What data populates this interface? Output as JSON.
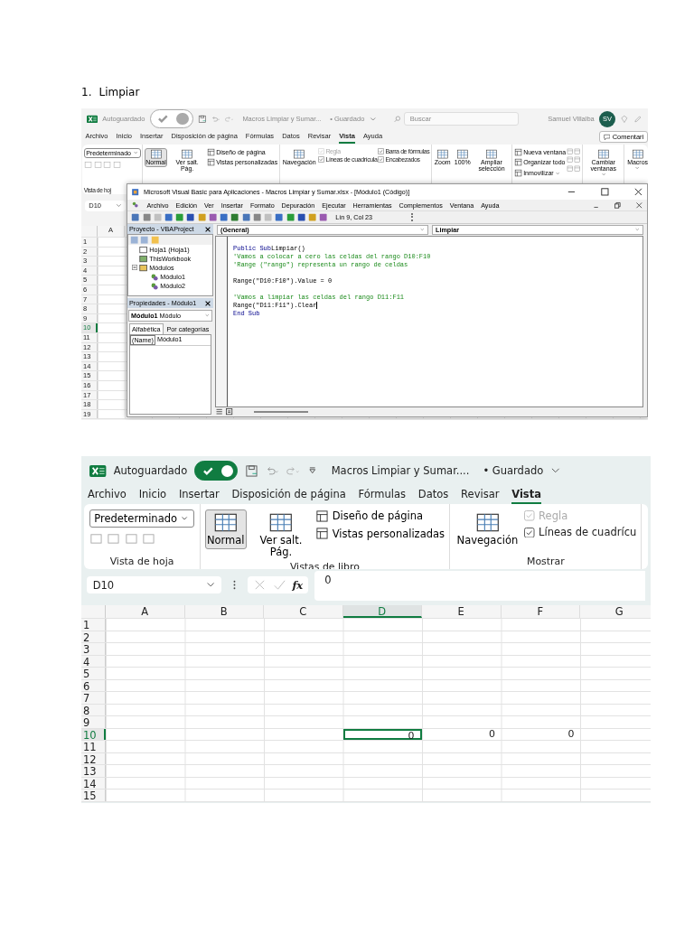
{
  "heading": {
    "number": "1.",
    "title": "Limpiar"
  },
  "screenshots": [
    {
      "title_bar": {
        "autosave_label": "Autoguardado",
        "autosave_on": true,
        "document": "Macros Limpiar y Sumar...",
        "saved_status": "• Guardado",
        "search_placeholder": "Buscar",
        "user": "Samuel Villalba",
        "avatar": "SV"
      },
      "menu_tabs": [
        {
          "label": "Archivo",
          "selected": false
        },
        {
          "label": "Inicio",
          "selected": false
        },
        {
          "label": "Insertar",
          "selected": false
        },
        {
          "label": "Disposición de página",
          "selected": false
        },
        {
          "label": "Fórmulas",
          "selected": false
        },
        {
          "label": "Datos",
          "selected": false
        },
        {
          "label": "Revisar",
          "selected": false
        },
        {
          "label": "Vista",
          "selected": true
        },
        {
          "label": "Ayuda",
          "selected": false
        }
      ],
      "comments_button": "Comentari",
      "ribbon_groups": [
        {
          "label": "Vista de hoj",
          "columns": [
            [
              {
                "kind": "dropdown",
                "label": "Predeterminado"
              },
              {
                "kind": "icon_row"
              }
            ]
          ]
        },
        {
          "columns": [
            [
              {
                "kind": "big",
                "label": "Normal",
                "selected": true
              }
            ],
            [
              {
                "kind": "big",
                "label": "Ver salt. Pág.",
                "selected": false
              }
            ],
            [
              {
                "kind": "small",
                "label": "Diseño de página"
              },
              {
                "kind": "small",
                "label": "Vistas personalizadas"
              }
            ]
          ]
        },
        {
          "columns": [
            [
              {
                "kind": "big",
                "label": "Navegación"
              }
            ],
            [
              {
                "kind": "check",
                "label": "Regla",
                "checked": true,
                "disabled": true
              },
              {
                "kind": "check",
                "label": "Líneas de cuadrícula",
                "checked": true,
                "disabled": false
              }
            ],
            [
              {
                "kind": "check",
                "label": "Barra de fórmulas",
                "checked": true,
                "disabled": false
              },
              {
                "kind": "check",
                "label": "Encabezados",
                "checked": true,
                "disabled": false
              }
            ]
          ]
        },
        {
          "columns": [
            [
              {
                "kind": "big",
                "label": "Zoom"
              }
            ],
            [
              {
                "kind": "big",
                "label": "100%"
              }
            ],
            [
              {
                "kind": "big",
                "label": "Ampliar selección"
              }
            ]
          ]
        },
        {
          "columns": [
            [
              {
                "kind": "small",
                "label": "Nueva ventana"
              },
              {
                "kind": "small",
                "label": "Organizar todo"
              },
              {
                "kind": "small",
                "label": "Inmovilizar",
                "menu": true
              }
            ],
            [
              {
                "kind": "icon_column"
              }
            ],
            [
              {
                "kind": "icon_column"
              }
            ]
          ]
        },
        {
          "columns": [
            [
              {
                "kind": "big",
                "label": "Cambiar ventanas",
                "menu": true
              }
            ]
          ]
        },
        {
          "columns": [
            [
              {
                "kind": "big",
                "label": "Macros",
                "menu": true
              }
            ]
          ]
        }
      ],
      "formula_bar": {
        "name_box": "D10"
      },
      "grid": {
        "columns": [
          {
            "label": "A",
            "selected": false
          }
        ],
        "rows": [
          {
            "label": "1",
            "selected": false
          },
          {
            "label": "2",
            "selected": false
          },
          {
            "label": "3",
            "selected": false
          },
          {
            "label": "4",
            "selected": false
          },
          {
            "label": "5",
            "selected": false
          },
          {
            "label": "6",
            "selected": false
          },
          {
            "label": "7",
            "selected": false
          },
          {
            "label": "8",
            "selected": false
          },
          {
            "label": "9",
            "selected": false
          },
          {
            "label": "10",
            "selected": true
          },
          {
            "label": "11",
            "selected": false
          },
          {
            "label": "12",
            "selected": false
          },
          {
            "label": "13",
            "selected": false
          },
          {
            "label": "14",
            "selected": false
          },
          {
            "label": "15",
            "selected": false
          },
          {
            "label": "16",
            "selected": false
          },
          {
            "label": "17",
            "selected": false
          },
          {
            "label": "18",
            "selected": false
          },
          {
            "label": "19",
            "selected": false
          }
        ]
      },
      "vba_window": {
        "title": "Microsoft Visual Basic para Aplicaciones - Macros Limpiar y Sumar.xlsx - [Módulo1 (Código)]",
        "menu": [
          "Archivo",
          "Edición",
          "Ver",
          "Insertar",
          "Formato",
          "Depuración",
          "Ejecutar",
          "Herramientas",
          "Complementos",
          "Ventana",
          "Ayuda"
        ],
        "position": "Lín 9, Col 23",
        "project_panel": {
          "title": "Proyecto - VBAProject",
          "tree": [
            {
              "label": "Hoja1 (Hoja1)",
              "kind": "sheet"
            },
            {
              "label": "ThisWorkbook",
              "kind": "workbook"
            },
            {
              "label": "Módulos",
              "kind": "folder",
              "expanded": true,
              "children": [
                {
                  "label": "Módulo1",
                  "kind": "module"
                },
                {
                  "label": "Módulo2",
                  "kind": "module"
                }
              ]
            }
          ]
        },
        "properties_panel": {
          "title": "Propiedades - Módulo1",
          "object_name": "Módulo1",
          "object_type": "Módulo",
          "tabs": [
            {
              "label": "Alfabética",
              "selected": true
            },
            {
              "label": "Por categorías",
              "selected": false
            }
          ],
          "rows": [
            {
              "name": "(Name)",
              "value": "Módulo1"
            }
          ]
        },
        "object_dropdown": "(General)",
        "procedure_dropdown": "Limpiar",
        "code": [
          {
            "kind": "code",
            "cursor": false,
            "tokens": [
              {
                "text": "Public Sub",
                "kind": "keyword"
              },
              {
                "text": "Limpiar()",
                "kind": "plain"
              }
            ]
          },
          {
            "kind": "code",
            "cursor": false,
            "tokens": [
              {
                "text": "'Vamos a colocar a cero las celdas del rango D10:F10",
                "kind": "comment"
              }
            ]
          },
          {
            "kind": "code",
            "cursor": false,
            "tokens": [
              {
                "text": "'Range (\"rango\") representa un rango de celdas",
                "kind": "comment"
              }
            ]
          },
          {
            "kind": "blank"
          },
          {
            "kind": "code",
            "cursor": false,
            "tokens": [
              {
                "text": "Range(\"D10:F10\").Value = 0",
                "kind": "plain"
              }
            ]
          },
          {
            "kind": "blank"
          },
          {
            "kind": "code",
            "cursor": false,
            "tokens": [
              {
                "text": "'Vamos a limpiar las celdas del rango D11:F11",
                "kind": "comment"
              }
            ]
          },
          {
            "kind": "code",
            "cursor": true,
            "tokens": [
              {
                "text": "Range(\"D11:F11\").Clear",
                "kind": "plain"
              }
            ]
          },
          {
            "kind": "code",
            "cursor": false,
            "tokens": [
              {
                "text": "End Sub",
                "kind": "keyword"
              }
            ]
          }
        ]
      }
    },
    {
      "title_bar": {
        "autosave_label": "Autoguardado",
        "autosave_on": true,
        "document": "Macros Limpiar y Sumar....",
        "saved_status": "• Guardado"
      },
      "menu_tabs": [
        {
          "label": "Archivo",
          "selected": false
        },
        {
          "label": "Inicio",
          "selected": false
        },
        {
          "label": "Insertar",
          "selected": false
        },
        {
          "label": "Disposición de página",
          "selected": false
        },
        {
          "label": "Fórmulas",
          "selected": false
        },
        {
          "label": "Datos",
          "selected": false
        },
        {
          "label": "Revisar",
          "selected": false
        },
        {
          "label": "Vista",
          "selected": true
        }
      ],
      "ribbon_groups": [
        {
          "label": "Vista de hoja",
          "columns": [
            [
              {
                "kind": "dropdown",
                "label": "Predeterminado"
              },
              {
                "kind": "icon_row"
              }
            ]
          ]
        },
        {
          "label": "Vistas de libro",
          "columns": [
            [
              {
                "kind": "big",
                "label": "Normal",
                "selected": true
              }
            ],
            [
              {
                "kind": "big",
                "label": "Ver salt. Pág.",
                "selected": false
              }
            ],
            [
              {
                "kind": "small",
                "label": "Diseño de página"
              },
              {
                "kind": "small",
                "label": "Vistas personalizadas"
              }
            ]
          ]
        },
        {
          "label": "Mostrar",
          "columns": [
            [
              {
                "kind": "big",
                "label": "Navegación"
              }
            ],
            [
              {
                "kind": "check",
                "label": "Regla",
                "checked": true,
                "disabled": true
              },
              {
                "kind": "check",
                "label": "Líneas de cuadrícu",
                "checked": true,
                "disabled": false
              }
            ]
          ]
        }
      ],
      "formula_bar": {
        "name_box": "D10",
        "function_symbol": "fx",
        "formula": "0"
      },
      "grid": {
        "columns": [
          {
            "label": "A",
            "selected": false
          },
          {
            "label": "B",
            "selected": false
          },
          {
            "label": "C",
            "selected": false
          },
          {
            "label": "D",
            "selected": true
          },
          {
            "label": "E",
            "selected": false
          },
          {
            "label": "F",
            "selected": false
          },
          {
            "label": "G",
            "selected": false
          }
        ],
        "rows": [
          {
            "label": "1",
            "selected": false
          },
          {
            "label": "2",
            "selected": false
          },
          {
            "label": "3",
            "selected": false
          },
          {
            "label": "4",
            "selected": false
          },
          {
            "label": "5",
            "selected": false
          },
          {
            "label": "6",
            "selected": false
          },
          {
            "label": "7",
            "selected": false
          },
          {
            "label": "8",
            "selected": false
          },
          {
            "label": "9",
            "selected": false
          },
          {
            "label": "10",
            "selected": true,
            "cells": [
              {
                "selected": false
              },
              {
                "selected": false
              },
              {
                "selected": false
              },
              {
                "value": "0",
                "selected": true
              },
              {
                "value": "0",
                "selected": false
              },
              {
                "value": "0",
                "selected": false
              },
              {
                "selected": false
              }
            ]
          },
          {
            "label": "11",
            "selected": false
          },
          {
            "label": "12",
            "selected": false
          },
          {
            "label": "13",
            "selected": false
          },
          {
            "label": "14",
            "selected": false
          },
          {
            "label": "15",
            "selected": false
          }
        ]
      }
    }
  ]
}
